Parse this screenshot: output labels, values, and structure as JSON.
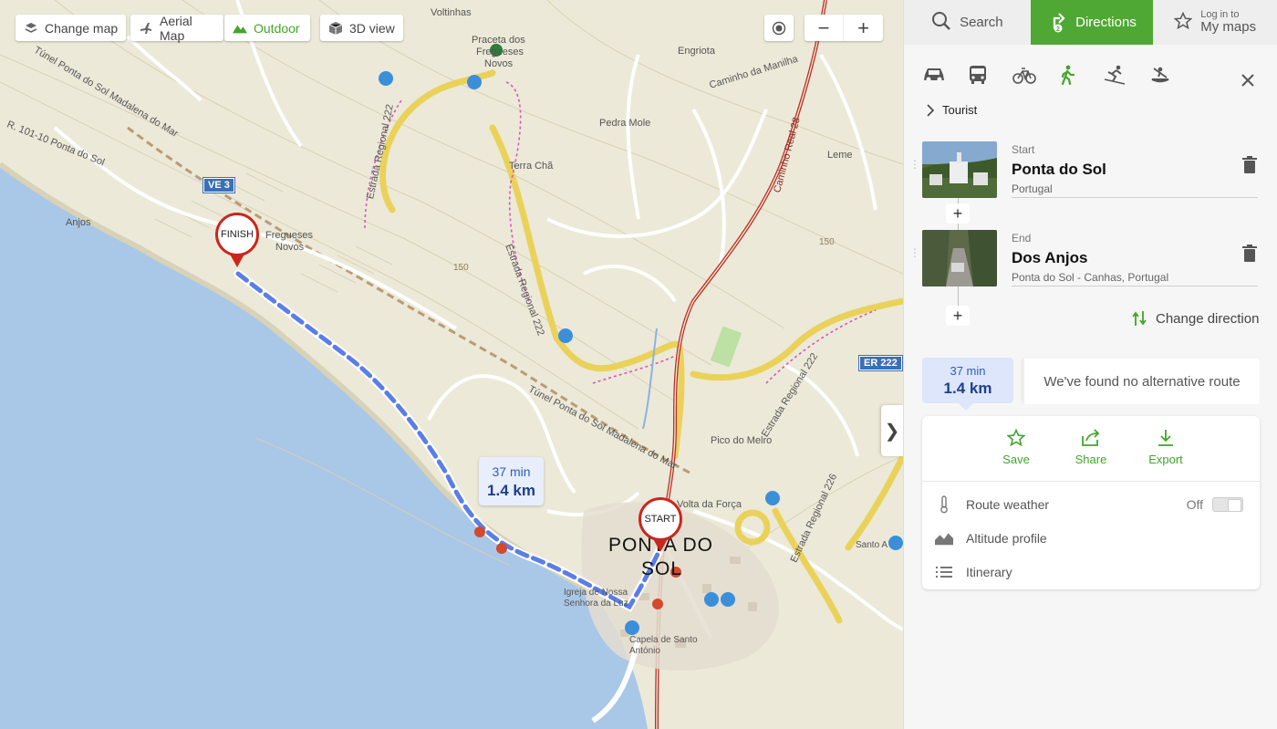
{
  "map_controls": {
    "change_map": "Change map",
    "aerial_map": "Aerial Map",
    "outdoor": "Outdoor",
    "view_3d": "3D view",
    "zoom_out": "−",
    "zoom_in": "+"
  },
  "map": {
    "labels": {
      "voltinhas": "Voltinhas",
      "praceta_1": "Praceta dos",
      "praceta_2": "Fregueses",
      "praceta_3": "Novos",
      "engriota": "Engriota",
      "caminho_manilha": "Caminho da Manilha",
      "caminho_real": "Caminho Real 28",
      "pedra_mole": "Pedra Mole",
      "terra_cha": "Terra Chã",
      "leme": "Leme",
      "anjos": "Anjos",
      "fregueses_1": "Fregueses",
      "fregueses_2": "Novos",
      "tunel": "Túnel Ponta do Sol Madalena do Mar",
      "tunel_top": "Túnel Ponta do Sol Madalena do Mar",
      "pico_melro": "Pico do Melro",
      "volta_forca": "Volta da Força",
      "ponta_sol_1": "PONTA DO",
      "ponta_sol_2": "SOL",
      "igreja": "Igreja de Nossa Senhora da Luz",
      "capela": "Capela de Santo António",
      "santo_a": "Santo A",
      "estrada_222": "Estrada Regional 222",
      "estrada_226": "Estrada Regional 226",
      "r101": "R. 101-10 Ponta do Sol",
      "elev_150a": "150",
      "elev_150b": "150"
    },
    "badges": {
      "ve3": "VE 3",
      "er222": "ER 222"
    },
    "finish_label": "FINISH",
    "start_label": "START",
    "route_bubble": {
      "time": "37 min",
      "distance": "1.4 km"
    }
  },
  "panel": {
    "nav": {
      "search": "Search",
      "directions": "Directions",
      "login_small": "Log in to",
      "login_main": "My maps"
    },
    "profile": "Tourist",
    "start": {
      "kind": "Start",
      "name": "Ponta do Sol",
      "sub": "Portugal"
    },
    "end": {
      "kind": "End",
      "name": "Dos Anjos",
      "sub": "Ponta do Sol - Canhas, Portugal"
    },
    "change_direction": "Change direction",
    "summary": {
      "time": "37 min",
      "distance": "1.4 km"
    },
    "no_alternative": "We've found no alternative route",
    "actions": {
      "save": "Save",
      "share": "Share",
      "export": "Export"
    },
    "rows": {
      "route_weather": "Route weather",
      "weather_state": "Off",
      "altitude_profile": "Altitude profile",
      "itinerary": "Itinerary"
    }
  },
  "colors": {
    "accent_green": "#4fa834",
    "route_blue": "#5b7ee6",
    "pin_red": "#c9271e",
    "sea": "#a9c7e6"
  }
}
